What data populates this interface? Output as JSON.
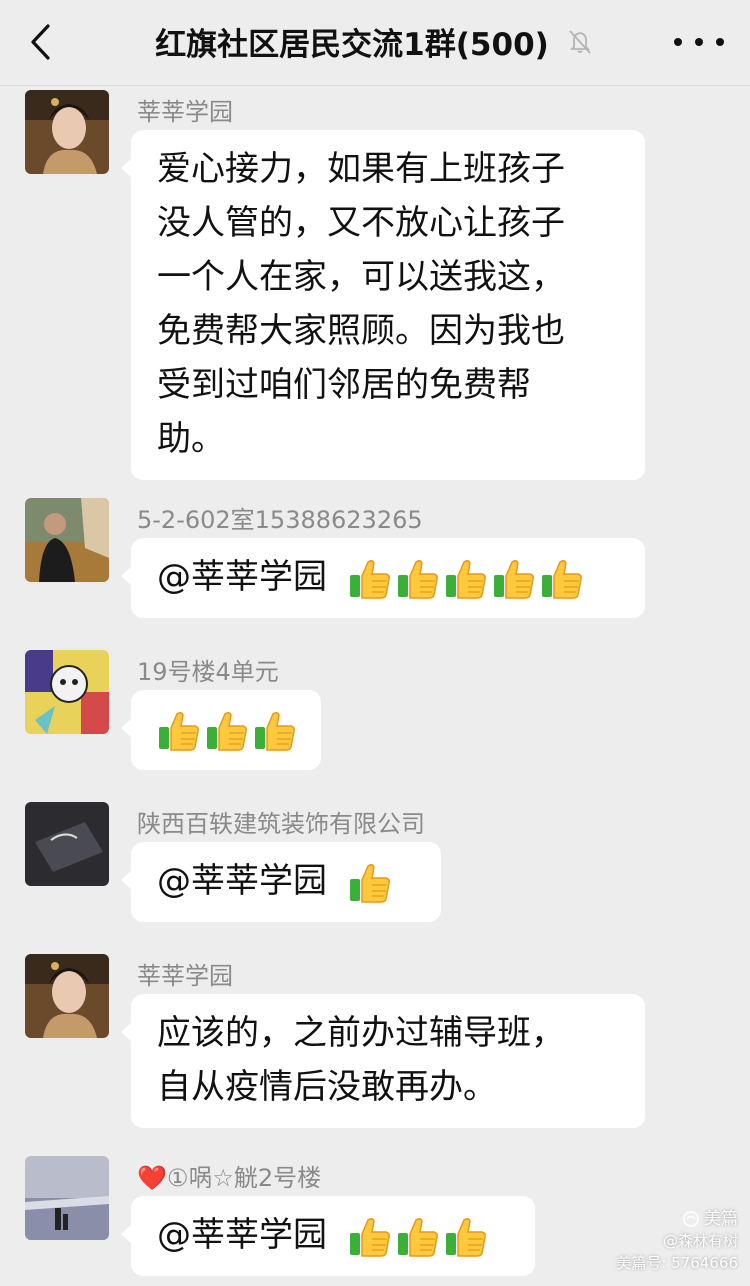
{
  "header": {
    "title": "红旗社区居民交流1群(500)",
    "back_icon": "chevron-left-icon",
    "mute_icon": "bell-off-icon",
    "more_icon": "more-dots-icon"
  },
  "messages": [
    {
      "sender": "莘莘学园",
      "lines": [
        "爱心接力，如果有上班孩子",
        "没人管的，又不放心让孩子",
        "一个人在家，可以送我这，",
        "免费帮大家照顾。因为我也",
        "受到过咱们邻居的免费帮",
        "助。"
      ]
    },
    {
      "sender": "5-2-602室15388623265",
      "mention": "@莘莘学园",
      "thumbs_up_count": 5
    },
    {
      "sender": "19号楼4单元",
      "thumbs_up_count": 3
    },
    {
      "sender": "陕西百轶建筑装饰有限公司",
      "mention": "@莘莘学园",
      "thumbs_up_count": 1
    },
    {
      "sender": "莘莘学园",
      "lines": [
        "应该的，之前办过辅导班，",
        "自从疫情后没敢再办。"
      ]
    },
    {
      "sender": "❤️①㖞☆觥2号楼",
      "mention": "@莘莘学园",
      "thumbs_up_count": 3
    }
  ],
  "watermark": {
    "logo": "美篇",
    "author": "@森林有树",
    "id": "美篇号: 5764666"
  },
  "colors": {
    "background": "#ededed",
    "bubble": "#ffffff",
    "sender_text": "#8a8a8a"
  }
}
